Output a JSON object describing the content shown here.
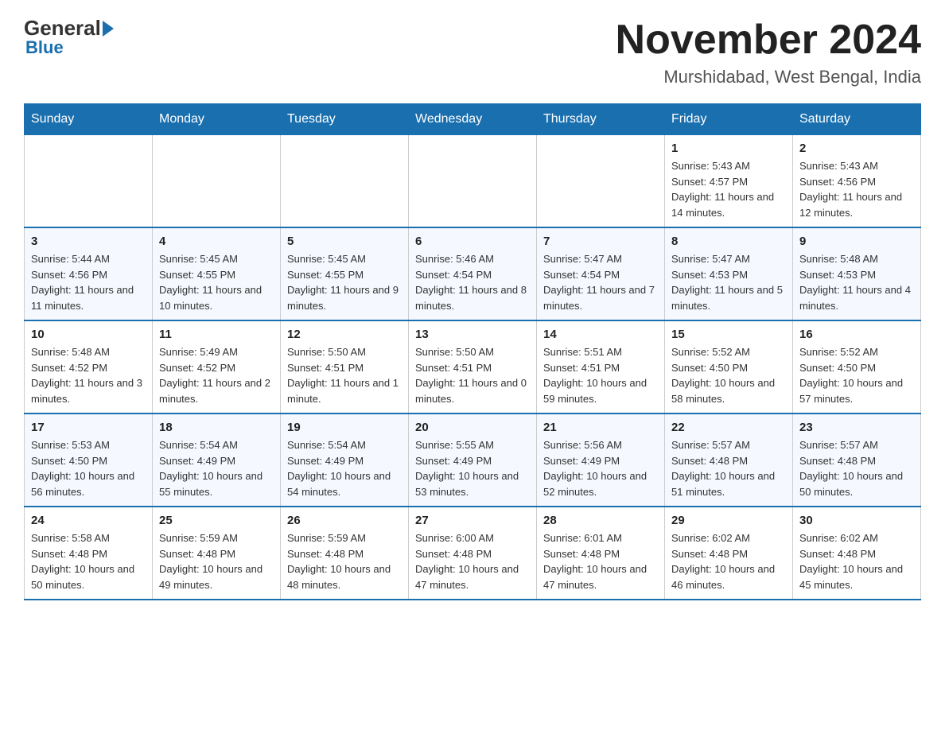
{
  "header": {
    "logo_general": "General",
    "logo_blue": "Blue",
    "month_year": "November 2024",
    "location": "Murshidabad, West Bengal, India"
  },
  "days_of_week": [
    "Sunday",
    "Monday",
    "Tuesday",
    "Wednesday",
    "Thursday",
    "Friday",
    "Saturday"
  ],
  "weeks": [
    [
      {
        "day": "",
        "sunrise": "",
        "sunset": "",
        "daylight": ""
      },
      {
        "day": "",
        "sunrise": "",
        "sunset": "",
        "daylight": ""
      },
      {
        "day": "",
        "sunrise": "",
        "sunset": "",
        "daylight": ""
      },
      {
        "day": "",
        "sunrise": "",
        "sunset": "",
        "daylight": ""
      },
      {
        "day": "",
        "sunrise": "",
        "sunset": "",
        "daylight": ""
      },
      {
        "day": "1",
        "sunrise": "Sunrise: 5:43 AM",
        "sunset": "Sunset: 4:57 PM",
        "daylight": "Daylight: 11 hours and 14 minutes."
      },
      {
        "day": "2",
        "sunrise": "Sunrise: 5:43 AM",
        "sunset": "Sunset: 4:56 PM",
        "daylight": "Daylight: 11 hours and 12 minutes."
      }
    ],
    [
      {
        "day": "3",
        "sunrise": "Sunrise: 5:44 AM",
        "sunset": "Sunset: 4:56 PM",
        "daylight": "Daylight: 11 hours and 11 minutes."
      },
      {
        "day": "4",
        "sunrise": "Sunrise: 5:45 AM",
        "sunset": "Sunset: 4:55 PM",
        "daylight": "Daylight: 11 hours and 10 minutes."
      },
      {
        "day": "5",
        "sunrise": "Sunrise: 5:45 AM",
        "sunset": "Sunset: 4:55 PM",
        "daylight": "Daylight: 11 hours and 9 minutes."
      },
      {
        "day": "6",
        "sunrise": "Sunrise: 5:46 AM",
        "sunset": "Sunset: 4:54 PM",
        "daylight": "Daylight: 11 hours and 8 minutes."
      },
      {
        "day": "7",
        "sunrise": "Sunrise: 5:47 AM",
        "sunset": "Sunset: 4:54 PM",
        "daylight": "Daylight: 11 hours and 7 minutes."
      },
      {
        "day": "8",
        "sunrise": "Sunrise: 5:47 AM",
        "sunset": "Sunset: 4:53 PM",
        "daylight": "Daylight: 11 hours and 5 minutes."
      },
      {
        "day": "9",
        "sunrise": "Sunrise: 5:48 AM",
        "sunset": "Sunset: 4:53 PM",
        "daylight": "Daylight: 11 hours and 4 minutes."
      }
    ],
    [
      {
        "day": "10",
        "sunrise": "Sunrise: 5:48 AM",
        "sunset": "Sunset: 4:52 PM",
        "daylight": "Daylight: 11 hours and 3 minutes."
      },
      {
        "day": "11",
        "sunrise": "Sunrise: 5:49 AM",
        "sunset": "Sunset: 4:52 PM",
        "daylight": "Daylight: 11 hours and 2 minutes."
      },
      {
        "day": "12",
        "sunrise": "Sunrise: 5:50 AM",
        "sunset": "Sunset: 4:51 PM",
        "daylight": "Daylight: 11 hours and 1 minute."
      },
      {
        "day": "13",
        "sunrise": "Sunrise: 5:50 AM",
        "sunset": "Sunset: 4:51 PM",
        "daylight": "Daylight: 11 hours and 0 minutes."
      },
      {
        "day": "14",
        "sunrise": "Sunrise: 5:51 AM",
        "sunset": "Sunset: 4:51 PM",
        "daylight": "Daylight: 10 hours and 59 minutes."
      },
      {
        "day": "15",
        "sunrise": "Sunrise: 5:52 AM",
        "sunset": "Sunset: 4:50 PM",
        "daylight": "Daylight: 10 hours and 58 minutes."
      },
      {
        "day": "16",
        "sunrise": "Sunrise: 5:52 AM",
        "sunset": "Sunset: 4:50 PM",
        "daylight": "Daylight: 10 hours and 57 minutes."
      }
    ],
    [
      {
        "day": "17",
        "sunrise": "Sunrise: 5:53 AM",
        "sunset": "Sunset: 4:50 PM",
        "daylight": "Daylight: 10 hours and 56 minutes."
      },
      {
        "day": "18",
        "sunrise": "Sunrise: 5:54 AM",
        "sunset": "Sunset: 4:49 PM",
        "daylight": "Daylight: 10 hours and 55 minutes."
      },
      {
        "day": "19",
        "sunrise": "Sunrise: 5:54 AM",
        "sunset": "Sunset: 4:49 PM",
        "daylight": "Daylight: 10 hours and 54 minutes."
      },
      {
        "day": "20",
        "sunrise": "Sunrise: 5:55 AM",
        "sunset": "Sunset: 4:49 PM",
        "daylight": "Daylight: 10 hours and 53 minutes."
      },
      {
        "day": "21",
        "sunrise": "Sunrise: 5:56 AM",
        "sunset": "Sunset: 4:49 PM",
        "daylight": "Daylight: 10 hours and 52 minutes."
      },
      {
        "day": "22",
        "sunrise": "Sunrise: 5:57 AM",
        "sunset": "Sunset: 4:48 PM",
        "daylight": "Daylight: 10 hours and 51 minutes."
      },
      {
        "day": "23",
        "sunrise": "Sunrise: 5:57 AM",
        "sunset": "Sunset: 4:48 PM",
        "daylight": "Daylight: 10 hours and 50 minutes."
      }
    ],
    [
      {
        "day": "24",
        "sunrise": "Sunrise: 5:58 AM",
        "sunset": "Sunset: 4:48 PM",
        "daylight": "Daylight: 10 hours and 50 minutes."
      },
      {
        "day": "25",
        "sunrise": "Sunrise: 5:59 AM",
        "sunset": "Sunset: 4:48 PM",
        "daylight": "Daylight: 10 hours and 49 minutes."
      },
      {
        "day": "26",
        "sunrise": "Sunrise: 5:59 AM",
        "sunset": "Sunset: 4:48 PM",
        "daylight": "Daylight: 10 hours and 48 minutes."
      },
      {
        "day": "27",
        "sunrise": "Sunrise: 6:00 AM",
        "sunset": "Sunset: 4:48 PM",
        "daylight": "Daylight: 10 hours and 47 minutes."
      },
      {
        "day": "28",
        "sunrise": "Sunrise: 6:01 AM",
        "sunset": "Sunset: 4:48 PM",
        "daylight": "Daylight: 10 hours and 47 minutes."
      },
      {
        "day": "29",
        "sunrise": "Sunrise: 6:02 AM",
        "sunset": "Sunset: 4:48 PM",
        "daylight": "Daylight: 10 hours and 46 minutes."
      },
      {
        "day": "30",
        "sunrise": "Sunrise: 6:02 AM",
        "sunset": "Sunset: 4:48 PM",
        "daylight": "Daylight: 10 hours and 45 minutes."
      }
    ]
  ]
}
